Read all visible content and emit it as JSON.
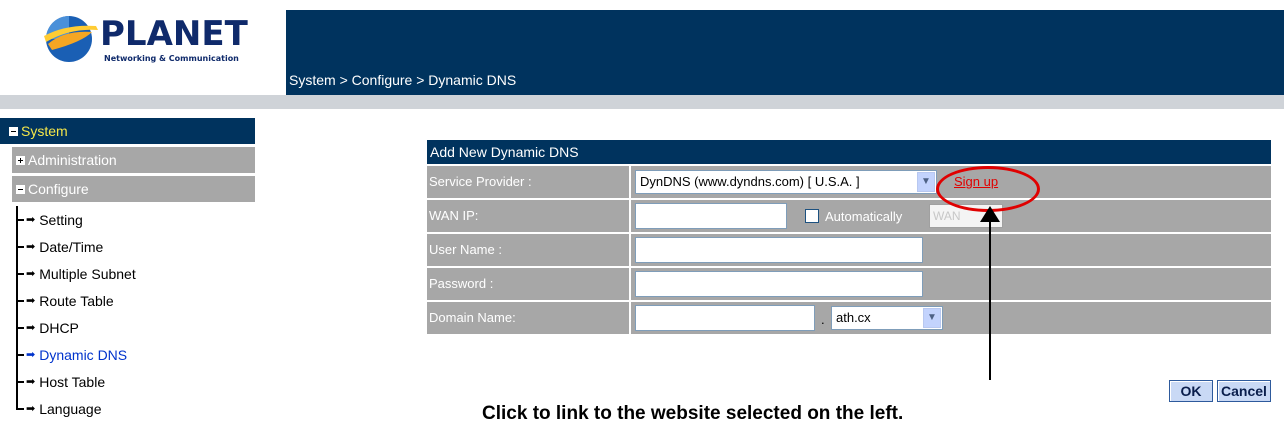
{
  "brand": {
    "name": "PLANET",
    "tagline": "Networking & Communication"
  },
  "breadcrumb": "System > Configure > Dynamic DNS",
  "sidebar": {
    "header": "System",
    "groups": [
      {
        "label": "Administration",
        "state": "collapsed"
      },
      {
        "label": "Configure",
        "state": "expanded"
      }
    ],
    "items": [
      {
        "label": "Setting"
      },
      {
        "label": "Date/Time"
      },
      {
        "label": "Multiple Subnet"
      },
      {
        "label": "Route Table"
      },
      {
        "label": "DHCP"
      },
      {
        "label": "Dynamic DNS",
        "active": true
      },
      {
        "label": "Host Table"
      },
      {
        "label": "Language"
      }
    ]
  },
  "form": {
    "title": "Add New Dynamic DNS",
    "service_provider": {
      "label": "Service Provider :",
      "selected": "DynDNS (www.dyndns.com) [ U.S.A. ]",
      "link": "Sign up"
    },
    "wan_ip": {
      "label": "WAN IP:",
      "value": "",
      "checkbox_label": "Automatically",
      "checkbox_checked": false,
      "select_value": "WAN"
    },
    "user_name": {
      "label": "User Name :",
      "value": ""
    },
    "password": {
      "label": "Password :",
      "value": ""
    },
    "domain_name": {
      "label": "Domain Name:",
      "host_value": "",
      "separator": ".",
      "domain_selected": "ath.cx"
    }
  },
  "buttons": {
    "ok": "OK",
    "cancel": "Cancel"
  },
  "annotation": {
    "text": "Click to link to the website selected on the left."
  },
  "colors": {
    "header_navy": "#00335e",
    "label_gray": "#a7a7a7",
    "highlight_red": "#e00000",
    "sidebar_header_text": "#f5e74a"
  }
}
